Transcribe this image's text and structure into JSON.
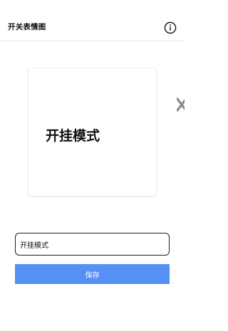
{
  "header": {
    "title": "开关表情图",
    "info_icon": "info-circle-icon"
  },
  "preview_card": {
    "text": "开挂模式"
  },
  "side_icon": "close-x-icon",
  "form": {
    "input_value": "开挂模式",
    "save_label": "保存"
  },
  "colors": {
    "accent": "#5590f5",
    "background": "#ffffff",
    "text": "#111111",
    "input_border": "#1e1e1e"
  }
}
